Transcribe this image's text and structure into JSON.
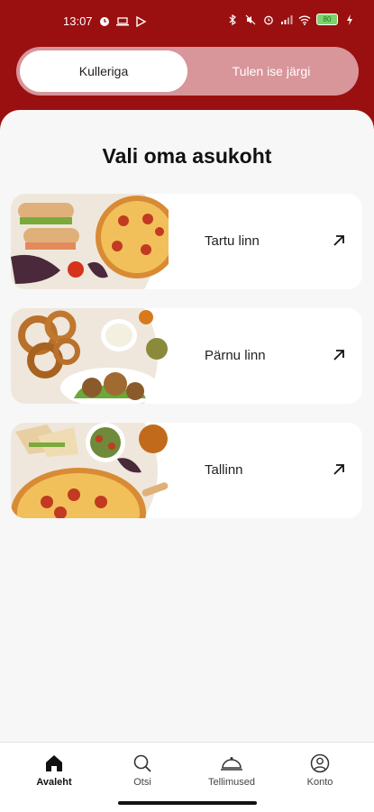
{
  "status_bar": {
    "time": "13:07",
    "battery": "80",
    "icons": [
      "clock-icon",
      "laptop-icon",
      "play-icon",
      "bluetooth-icon",
      "mute-icon",
      "alarm-icon",
      "signal-icon",
      "wifi-icon",
      "battery-icon",
      "charging-icon"
    ]
  },
  "delivery_toggle": {
    "active_label": "Kulleriga",
    "inactive_label": "Tulen ise järgi"
  },
  "page_title": "Vali oma asukoht",
  "locations": [
    {
      "name": "Tartu linn",
      "icon": "arrow-up-right-icon"
    },
    {
      "name": "Pärnu linn",
      "icon": "arrow-up-right-icon"
    },
    {
      "name": "Tallinn",
      "icon": "arrow-up-right-icon"
    }
  ],
  "bottom_nav": [
    {
      "label": "Avaleht",
      "icon": "home-icon",
      "active": true
    },
    {
      "label": "Otsi",
      "icon": "search-icon",
      "active": false
    },
    {
      "label": "Tellimused",
      "icon": "cloche-icon",
      "active": false
    },
    {
      "label": "Konto",
      "icon": "account-icon",
      "active": false
    }
  ],
  "colors": {
    "brand": "#9a1010",
    "toggle_bg": "#d8959a",
    "sheet_bg": "#f7f7f7"
  }
}
